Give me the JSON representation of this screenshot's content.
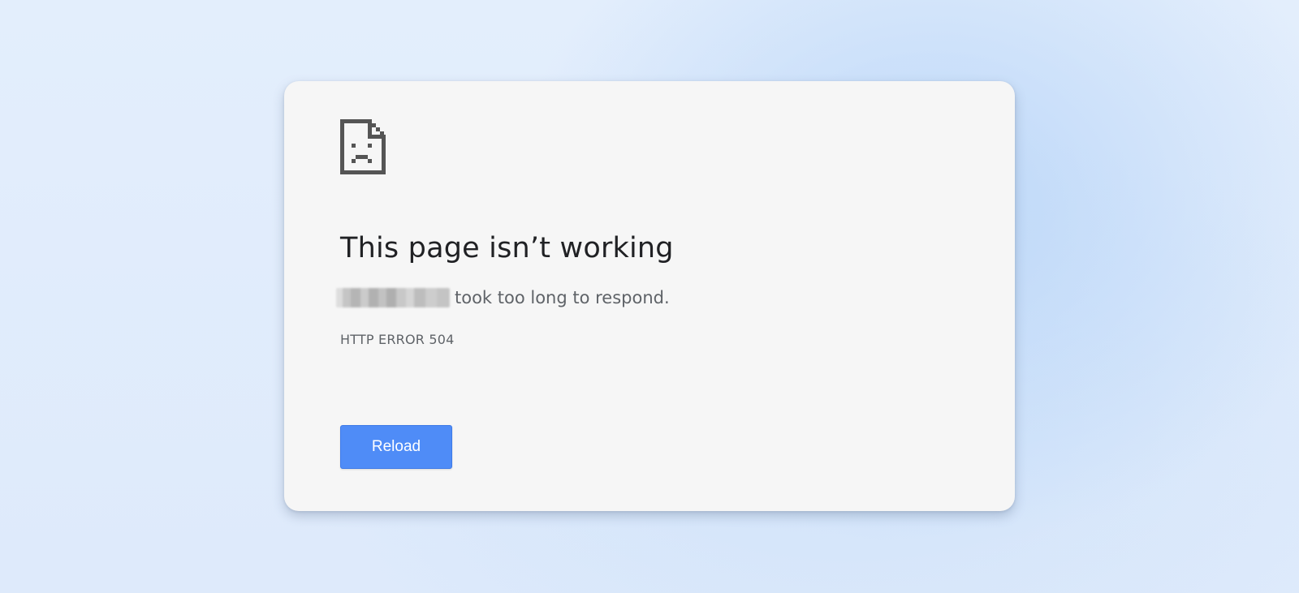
{
  "error": {
    "icon": "sad-page-icon",
    "title": "This page isn’t working",
    "message_suffix": "took too long to respond.",
    "code": "HTTP ERROR 504"
  },
  "actions": {
    "reload_label": "Reload"
  },
  "colors": {
    "background": "#e3eefc",
    "card": "#f6f6f6",
    "title_text": "#202124",
    "secondary_text": "#5f6368",
    "icon": "#555555",
    "button": "#4f8cf7",
    "button_text": "#ffffff"
  }
}
